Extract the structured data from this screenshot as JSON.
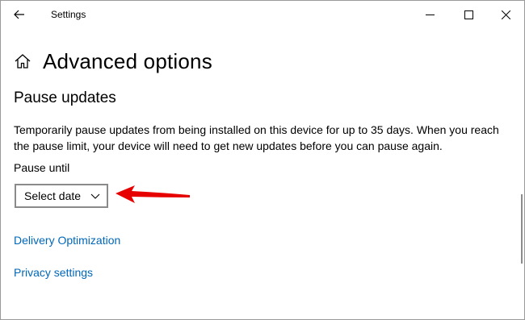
{
  "window": {
    "app_title": "Settings"
  },
  "header": {
    "title": "Advanced options"
  },
  "section": {
    "title": "Pause updates",
    "description": "Temporarily pause updates from being installed on this device for up to 35 days. When you reach the pause limit, your device will need to get new updates before you can pause again.",
    "pause_label": "Pause until",
    "select_value": "Select date"
  },
  "links": {
    "delivery": "Delivery Optimization",
    "privacy": "Privacy settings"
  },
  "colors": {
    "link": "#0067b8",
    "annotation_arrow": "#e60000"
  },
  "icons": [
    "back-arrow-icon",
    "minimize-icon",
    "maximize-icon",
    "close-icon",
    "home-icon",
    "chevron-down-icon"
  ]
}
